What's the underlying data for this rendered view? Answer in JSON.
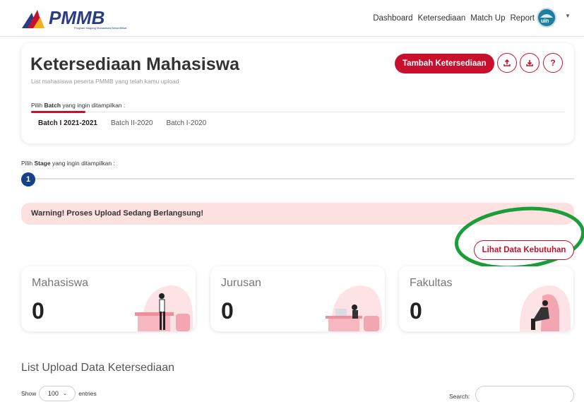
{
  "nav": {
    "logo_text": "Program Magang Mahasiswa Bersertifikat",
    "links": [
      "Dashboard",
      "Ketersediaan",
      "Match Up",
      "Report"
    ],
    "avatar_text": "uin"
  },
  "header": {
    "title": "Ketersediaan Mahasiswa",
    "subtitle": "List mahasiswa peserta PMMB yang telah kamu upload",
    "add_button": "Tambah Ketersediaan",
    "help_label": "?",
    "batch_prompt_pre": "Pilih ",
    "batch_prompt_bold": "Batch",
    "batch_prompt_post": " yang ingin ditampilkan :",
    "batches": [
      "Batch I 2021-2021",
      "Batch II-2020",
      "Batch I-2020"
    ],
    "active_batch": "Batch I 2021-2021"
  },
  "stage": {
    "prompt_pre": "Pilih ",
    "prompt_bold": "Stage",
    "prompt_post": " yang ingin ditampilkan :",
    "current": "1"
  },
  "warning": "Warning! Proses Upload Sedang Berlangsung!",
  "kebutuhan_button": "Lihat Data Kebutuhan",
  "stats": [
    {
      "label": "Mahasiswa",
      "value": "0"
    },
    {
      "label": "Jurusan",
      "value": "0"
    },
    {
      "label": "Fakultas",
      "value": "0"
    }
  ],
  "list": {
    "title": "List Upload Data Ketersediaan",
    "show_label": "Show",
    "entries_value": "100",
    "entries_label": "entries",
    "search_label": "Search:"
  },
  "colors": {
    "brand_red": "#c8102e",
    "stage_blue": "#16418a",
    "warning_bg": "#fde1e1",
    "annotation_green": "#1a9e3a"
  }
}
